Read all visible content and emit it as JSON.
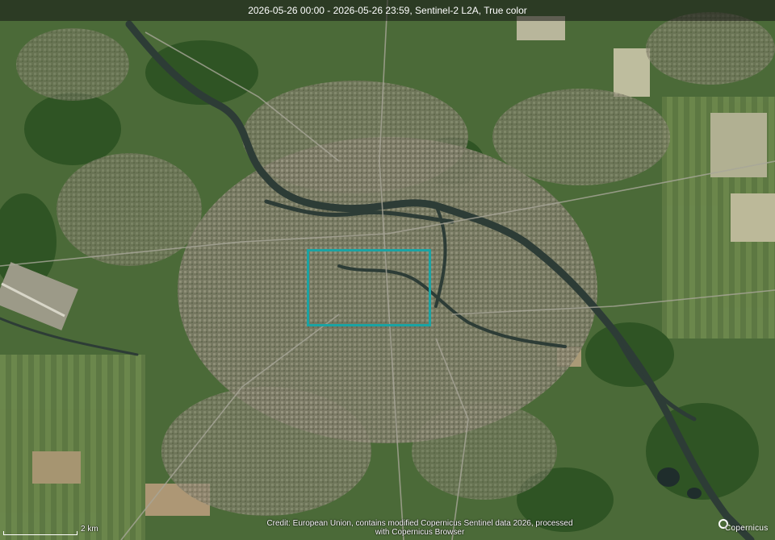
{
  "header": {
    "title": "2026-05-26 00:00 - 2026-05-26 23:59, Sentinel-2 L2A, True color"
  },
  "scale": {
    "label": "2 km"
  },
  "attribution": {
    "line1": "Credit: European Union, contains modified Copernicus Sentinel data 2026, processed",
    "line2": "with Copernicus Browser"
  },
  "logo": {
    "text": "Copernicus",
    "icon": "copernicus-logo-icon"
  },
  "colors": {
    "aoi_outline": "#1aa3a3",
    "river": "#2f3f3a",
    "vegetation": "#3f6a30",
    "urban": "#8a8570",
    "fields": "#b8b49a"
  }
}
